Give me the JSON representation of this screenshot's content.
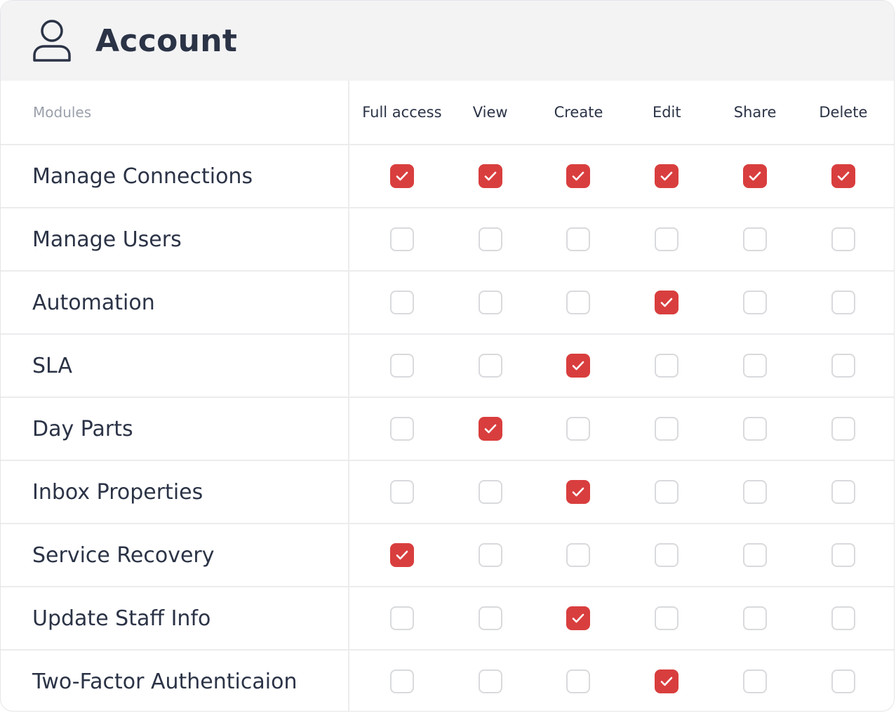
{
  "header": {
    "title": "Account",
    "icon": "user-icon"
  },
  "table": {
    "module_header": "Modules",
    "columns": [
      "Full access",
      "View",
      "Create",
      "Edit",
      "Share",
      "Delete"
    ],
    "rows": [
      {
        "name": "Manage Connections",
        "checked": [
          true,
          true,
          true,
          true,
          true,
          true
        ]
      },
      {
        "name": "Manage Users",
        "checked": [
          false,
          false,
          false,
          false,
          false,
          false
        ]
      },
      {
        "name": "Automation",
        "checked": [
          false,
          false,
          false,
          true,
          false,
          false
        ]
      },
      {
        "name": "SLA",
        "checked": [
          false,
          false,
          true,
          false,
          false,
          false
        ]
      },
      {
        "name": "Day Parts",
        "checked": [
          false,
          true,
          false,
          false,
          false,
          false
        ]
      },
      {
        "name": "Inbox Properties",
        "checked": [
          false,
          false,
          true,
          false,
          false,
          false
        ]
      },
      {
        "name": "Service Recovery",
        "checked": [
          true,
          false,
          false,
          false,
          false,
          false
        ]
      },
      {
        "name": "Update Staff Info",
        "checked": [
          false,
          false,
          true,
          false,
          false,
          false
        ]
      },
      {
        "name": "Two-Factor Authenticaion",
        "checked": [
          false,
          false,
          false,
          true,
          false,
          false
        ]
      }
    ]
  },
  "colors": {
    "accent": "#d93e3e",
    "text": "#2b3346",
    "muted": "#9aa0ab",
    "header_bg": "#f3f3f4",
    "divider": "#ececee"
  }
}
